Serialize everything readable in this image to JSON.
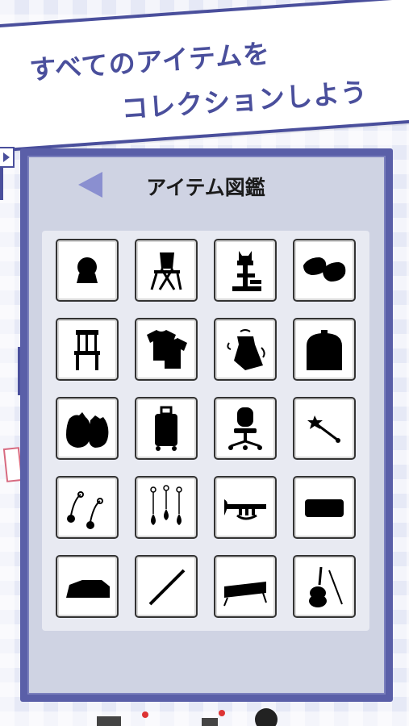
{
  "banner": {
    "line1": "すべてのアイテムを",
    "line2": "コレクションしよう"
  },
  "panel": {
    "title": "アイテム図鑑",
    "back_icon": "left-triangle-icon"
  },
  "items": [
    {
      "icon": "crystal-ball-icon"
    },
    {
      "icon": "folding-chair-icon"
    },
    {
      "icon": "cat-tower-icon"
    },
    {
      "icon": "slippers-icon"
    },
    {
      "icon": "wooden-chair-icon"
    },
    {
      "icon": "t-shirts-icon"
    },
    {
      "icon": "apron-icon"
    },
    {
      "icon": "kerosene-tank-icon"
    },
    {
      "icon": "sacks-icon"
    },
    {
      "icon": "suitcase-icon"
    },
    {
      "icon": "office-chair-icon"
    },
    {
      "icon": "magic-wand-icon"
    },
    {
      "icon": "maracas-icon"
    },
    {
      "icon": "hanging-drops-icon"
    },
    {
      "icon": "trumpet-icon"
    },
    {
      "icon": "pencil-case-icon"
    },
    {
      "icon": "piano-case-icon"
    },
    {
      "icon": "flute-icon"
    },
    {
      "icon": "xylophone-icon"
    },
    {
      "icon": "violin-icon"
    }
  ],
  "colors": {
    "accent": "#4a4f9c",
    "panel": "#cfd3e3",
    "back_arrow": "#8a8fd0"
  }
}
